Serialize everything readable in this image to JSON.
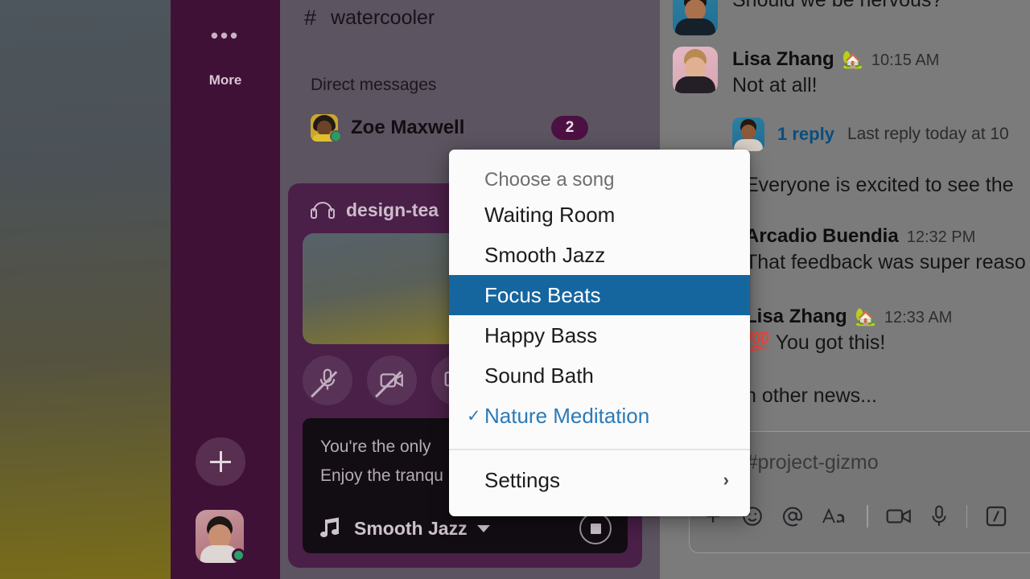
{
  "left_rail": {
    "more_label": "More",
    "more_icon": "ellipsis-icon",
    "add_icon": "plus-icon",
    "avatar_icon": "user-avatar"
  },
  "sidebar": {
    "channel": {
      "hash": "#",
      "name": "watercooler"
    },
    "dm_section_label": "Direct messages",
    "dms": [
      {
        "name": "Zoe Maxwell",
        "badge": "2",
        "presence": "online"
      }
    ]
  },
  "huddle": {
    "title": "design-tea",
    "headphones_icon": "headphones-icon",
    "controls": [
      {
        "name": "mic-muted-icon",
        "state": "muted"
      },
      {
        "name": "video-off-icon",
        "state": "off"
      },
      {
        "name": "screen-share-icon",
        "state": "idle"
      }
    ],
    "status_line1": "You're the only",
    "status_line2": "Enjoy the tranqu",
    "music": {
      "note_icon": "music-note-icon",
      "track": "Smooth Jazz",
      "caret_icon": "chevron-down-icon",
      "stop_icon": "stop-icon"
    }
  },
  "menu": {
    "header": "Choose a song",
    "items": [
      {
        "label": "Waiting Room",
        "selected": false,
        "checked": false
      },
      {
        "label": "Smooth Jazz",
        "selected": false,
        "checked": false
      },
      {
        "label": "Focus Beats",
        "selected": true,
        "checked": false
      },
      {
        "label": "Happy Bass",
        "selected": false,
        "checked": false
      },
      {
        "label": "Sound Bath",
        "selected": false,
        "checked": false
      },
      {
        "label": "Nature Meditation",
        "selected": false,
        "checked": true
      }
    ],
    "check_glyph": "✓",
    "settings_label": "Settings",
    "settings_chevron": "›",
    "highlight_color": "#15659f",
    "checked_color": "#2b7ab8"
  },
  "messages": {
    "items": [
      {
        "text": "Should we be nervous?"
      },
      {
        "author": "Lisa Zhang",
        "emoji": "🏡",
        "time": "10:15 AM",
        "text": "Not at all!"
      },
      {
        "reply_count": "1 reply",
        "reply_meta": "Last reply today at 10"
      },
      {
        "text": "Everyone is excited to see the"
      },
      {
        "author": "Arcadio Buendia",
        "time": "12:32 PM",
        "text": "That feedback was super reaso"
      },
      {
        "author": "Lisa Zhang",
        "emoji": "🏡",
        "time": "12:33 AM",
        "text": "💯 You got this!"
      },
      {
        "text": "n other news..."
      }
    ]
  },
  "composer": {
    "placeholder": "age #project-gizmo",
    "tools": [
      "plus-icon",
      "emoji-icon",
      "mention-icon",
      "format-text-icon",
      "video-icon",
      "microphone-icon",
      "slash-command-icon"
    ]
  }
}
